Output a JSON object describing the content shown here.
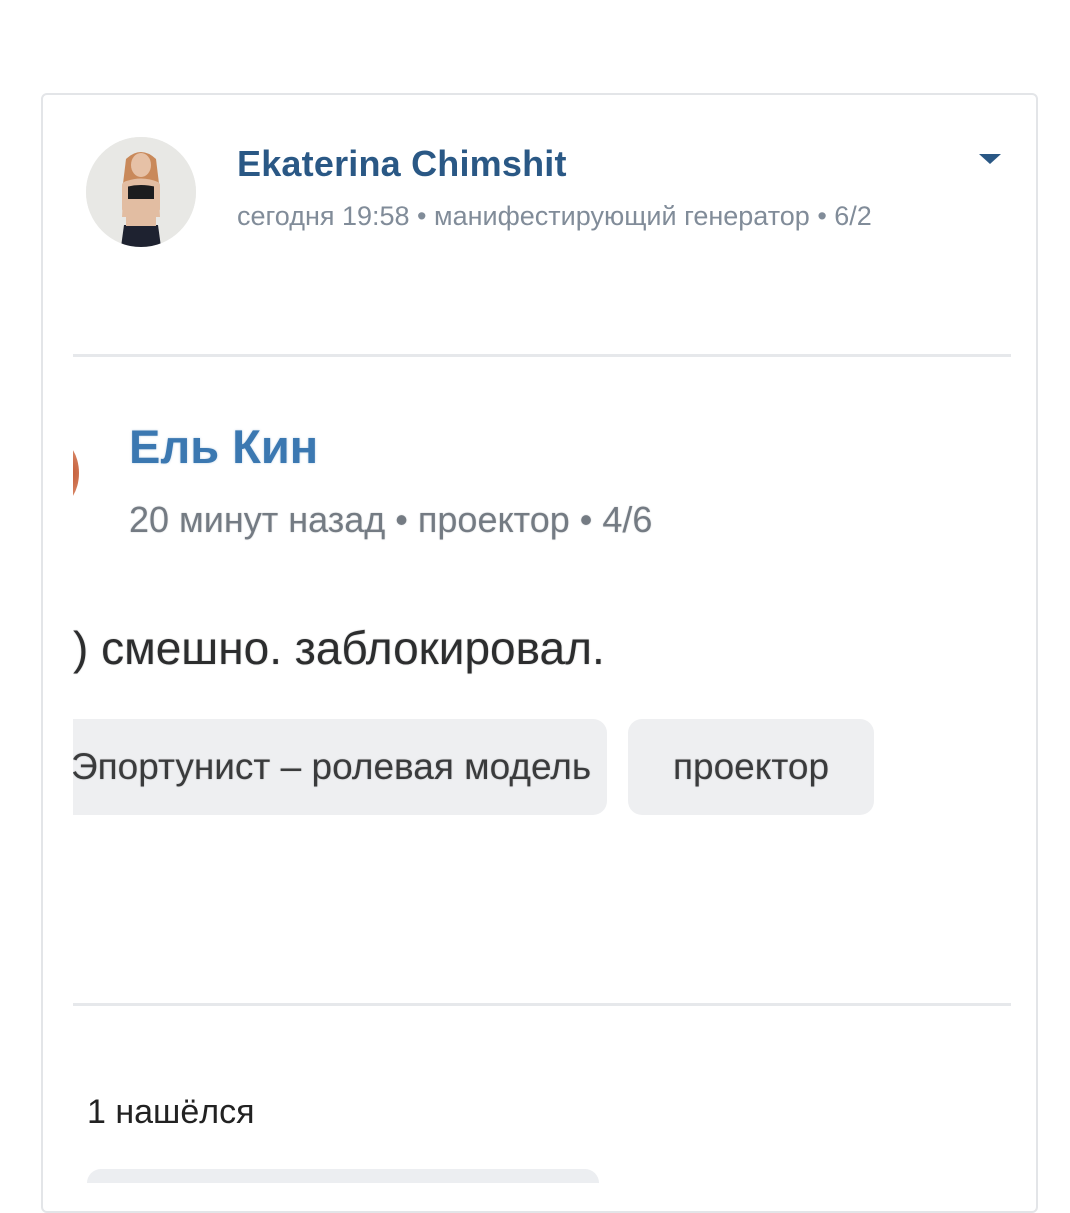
{
  "post": {
    "author_name": "Ekaterina Chimshit",
    "meta": "сегодня 19:58 • манифестирующий генератор • 6/2",
    "menu_icon": "chevron-down-icon",
    "accent_color": "#2a5885"
  },
  "screenshot": {
    "author_name": "Ель Кин",
    "meta": "20 минут назад • проектор • 4/6",
    "text": ") смешно. заблокировал.",
    "tags": [
      {
        "label": "Эпортунист – ролевая модель"
      },
      {
        "label": "проектор"
      }
    ]
  },
  "results": {
    "found_label": "1 нашёлся"
  }
}
